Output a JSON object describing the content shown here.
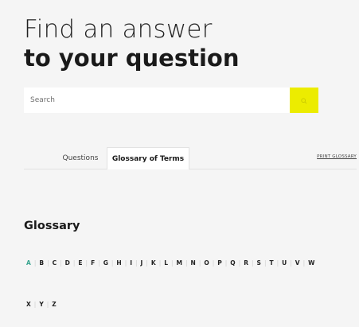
{
  "header": {
    "title_line1": "Find an answer",
    "title_line2": "to your question"
  },
  "search": {
    "placeholder": "Search",
    "button_icon": "search-icon",
    "button_color": "#ecec00"
  },
  "tabs": {
    "items": [
      {
        "label": "Questions",
        "selected": false
      },
      {
        "label": "Glossary of Terms",
        "selected": true
      }
    ],
    "print_label": "PRINT GLOSSARY"
  },
  "glossary": {
    "heading": "Glossary",
    "active_letter": "A",
    "active_color": "#3aa590",
    "letters_row1": [
      "A",
      "B",
      "C",
      "D",
      "E",
      "F",
      "G",
      "H",
      "I",
      "J",
      "K",
      "L",
      "M",
      "N",
      "O",
      "P",
      "Q",
      "R",
      "S",
      "T",
      "U",
      "V",
      "W"
    ],
    "letters_row2": [
      "X",
      "Y",
      "Z"
    ]
  }
}
